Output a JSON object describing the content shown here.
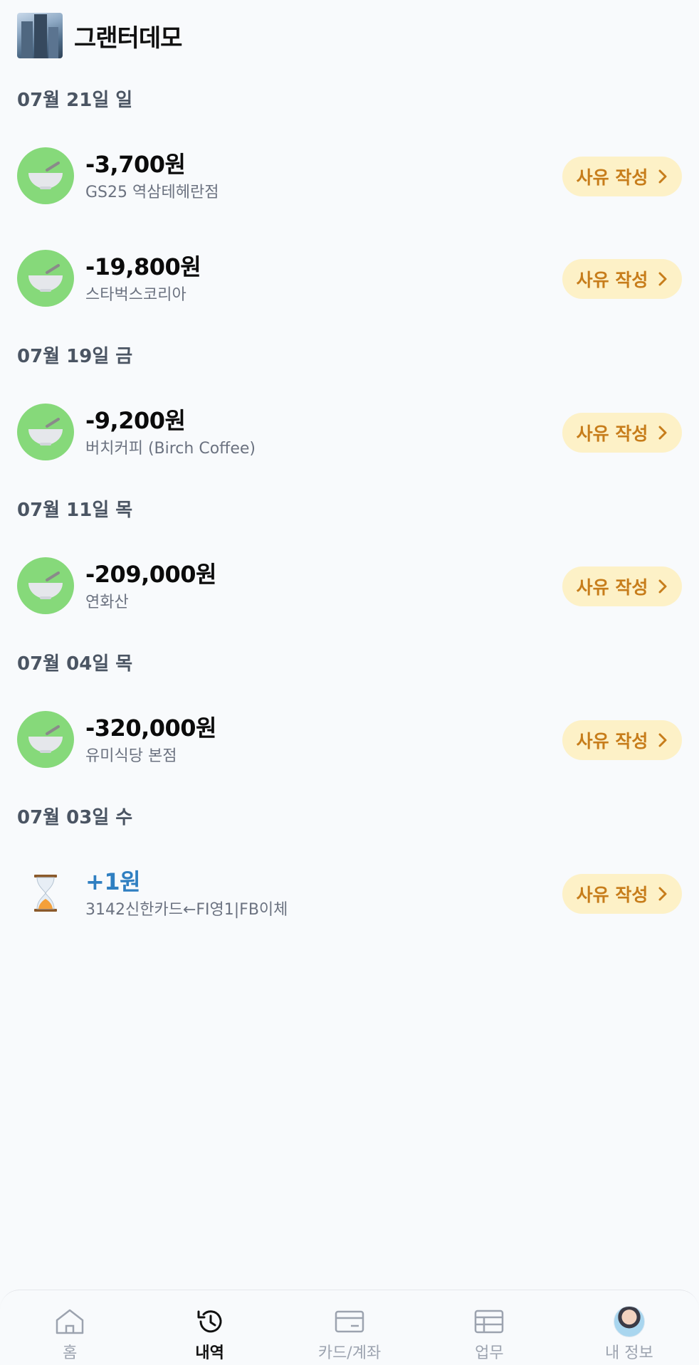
{
  "header": {
    "title": "그랜터데모"
  },
  "groups": [
    {
      "date": "07월 21일 일",
      "transactions": [
        {
          "amount": "-3,700원",
          "merchant": "GS25 역삼테헤란점",
          "icon": "bowl-icon",
          "button": "사유 작성"
        },
        {
          "amount": "-19,800원",
          "merchant": "스타벅스코리아",
          "icon": "bowl-icon",
          "button": "사유 작성"
        }
      ]
    },
    {
      "date": "07월 19일 금",
      "transactions": [
        {
          "amount": "-9,200원",
          "merchant": "버치커피 (Birch Coffee)",
          "icon": "bowl-icon",
          "button": "사유 작성"
        }
      ]
    },
    {
      "date": "07월 11일 목",
      "transactions": [
        {
          "amount": "-209,000원",
          "merchant": "연화산",
          "icon": "bowl-icon",
          "button": "사유 작성"
        }
      ]
    },
    {
      "date": "07월 04일 목",
      "transactions": [
        {
          "amount": "-320,000원",
          "merchant": "유미식당 본점",
          "icon": "bowl-icon",
          "button": "사유 작성"
        }
      ]
    },
    {
      "date": "07월 03일 수",
      "transactions": [
        {
          "amount": "+1원",
          "merchant": "3142신한카드←FI영1|FB이체",
          "icon": "hourglass-icon",
          "button": "사유 작성"
        }
      ]
    }
  ],
  "tabs": [
    {
      "label": "홈",
      "icon": "home-icon",
      "active": false
    },
    {
      "label": "내역",
      "icon": "history-icon",
      "active": true
    },
    {
      "label": "카드/계좌",
      "icon": "card-icon",
      "active": false
    },
    {
      "label": "업무",
      "icon": "table-icon",
      "active": false
    },
    {
      "label": "내 정보",
      "icon": "avatar",
      "active": false
    }
  ],
  "colors": {
    "accent_button_bg": "#fdf1c7",
    "accent_button_text": "#c77d1b",
    "icon_green": "#86d97a",
    "positive_amount": "#2f7fc1"
  }
}
